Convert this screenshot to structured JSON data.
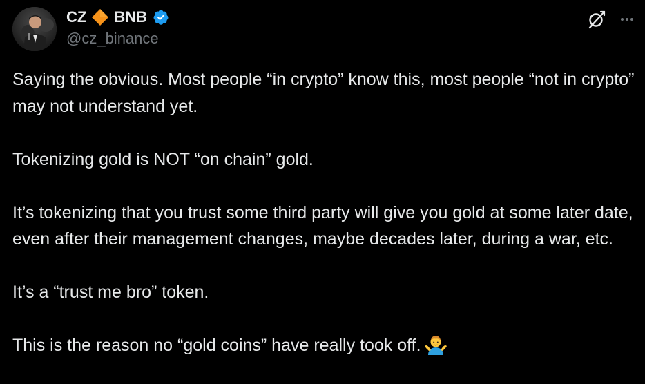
{
  "author": {
    "name_first": "CZ",
    "name_second": "BNB",
    "handle": "@cz_binance",
    "avatar_icon": "profile-photo",
    "badge_icon": "orange-diamond-icon",
    "verified_icon": "verified-badge-icon",
    "verified_color": "#1d9bf0",
    "diamond_color": "#f7931a"
  },
  "actions": {
    "grok_icon": "grok-icon",
    "more_icon": "more-icon"
  },
  "tweet": {
    "paragraphs": [
      "Saying the obvious. Most people “in crypto” know this, most people “not in crypto” may not understand yet.",
      "Tokenizing gold is NOT “on chain” gold.",
      "It’s tokenizing that you trust some third party will give you gold at some later date, even after their management changes, maybe decades later, during a war, etc.",
      "It’s a “trust me bro” token.",
      "This is the reason no “gold coins” have really took off."
    ],
    "trailing_emoji": "man-shrugging-emoji"
  },
  "colors": {
    "background": "#000000",
    "text": "#e7e9ea",
    "secondary": "#71767b"
  }
}
